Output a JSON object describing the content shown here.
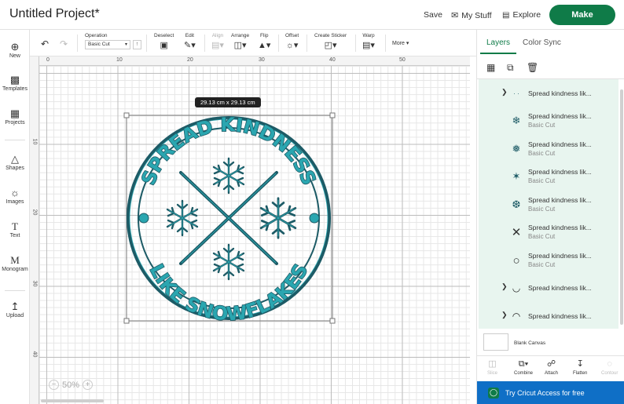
{
  "header": {
    "project_title": "Untitled Project*",
    "save_label": "Save",
    "my_stuff_label": "My Stuff",
    "explore_label": "Explore",
    "make_label": "Make"
  },
  "left_rail": {
    "items": [
      {
        "label": "New",
        "icon": "plus-icon"
      },
      {
        "label": "Templates",
        "icon": "tshirt-icon"
      },
      {
        "label": "Projects",
        "icon": "folder-icon"
      },
      {
        "label": "Shapes",
        "icon": "shapes-icon"
      },
      {
        "label": "Images",
        "icon": "lightbulb-icon"
      },
      {
        "label": "Text",
        "icon": "text-icon"
      },
      {
        "label": "Monogram",
        "icon": "monogram-icon"
      },
      {
        "label": "Upload",
        "icon": "upload-icon"
      }
    ]
  },
  "toolbar": {
    "operation_label": "Operation",
    "operation_value": "Basic Cut",
    "deselect_label": "Deselect",
    "edit_label": "Edit",
    "align_label": "Align",
    "arrange_label": "Arrange",
    "flip_label": "Flip",
    "offset_label": "Offset",
    "create_sticker_label": "Create Sticker",
    "warp_label": "Warp",
    "more_label": "More"
  },
  "canvas": {
    "ruler_top": [
      "0",
      "10",
      "20",
      "30",
      "40",
      "50"
    ],
    "ruler_left": [
      "10",
      "20",
      "30",
      "40"
    ],
    "dimension_badge": "29.13  cm x 29.13  cm",
    "zoom_level": "50%",
    "artwork_top_text": "SPREAD KINDNESS",
    "artwork_bottom_text": "LIKE SNOWFLAKES",
    "colors": {
      "dark_teal": "#1d5b66",
      "light_teal": "#2aa6b0"
    }
  },
  "panel": {
    "tab_layers": "Layers",
    "tab_color_sync": "Color Sync",
    "layers": [
      {
        "name": "Spread kindness lik...",
        "op": "",
        "thumb": "dots-icon",
        "group": true
      },
      {
        "name": "Spread kindness lik...",
        "op": "Basic Cut",
        "thumb": "snowflake-icon",
        "group": false
      },
      {
        "name": "Spread kindness lik...",
        "op": "Basic Cut",
        "thumb": "snowflake-icon",
        "group": false
      },
      {
        "name": "Spread kindness lik...",
        "op": "Basic Cut",
        "thumb": "snowflake-icon",
        "group": false
      },
      {
        "name": "Spread kindness lik...",
        "op": "Basic Cut",
        "thumb": "snowflake-icon",
        "group": false
      },
      {
        "name": "Spread kindness lik...",
        "op": "Basic Cut",
        "thumb": "x-cross-icon",
        "group": false
      },
      {
        "name": "Spread kindness lik...",
        "op": "Basic Cut",
        "thumb": "circle-icon",
        "group": false
      },
      {
        "name": "Spread kindness lik...",
        "op": "",
        "thumb": "smile-arc-icon",
        "group": true
      },
      {
        "name": "Spread kindness lik...",
        "op": "",
        "thumb": "frown-arc-icon",
        "group": true
      }
    ],
    "blank_canvas_label": "Blank Canvas",
    "bottom_tools": {
      "slice": "Slice",
      "combine": "Combine",
      "attach": "Attach",
      "flatten": "Flatten",
      "contour": "Contour"
    },
    "access_label": "Try Cricut Access for free"
  },
  "accent_color": "#0f7b48"
}
